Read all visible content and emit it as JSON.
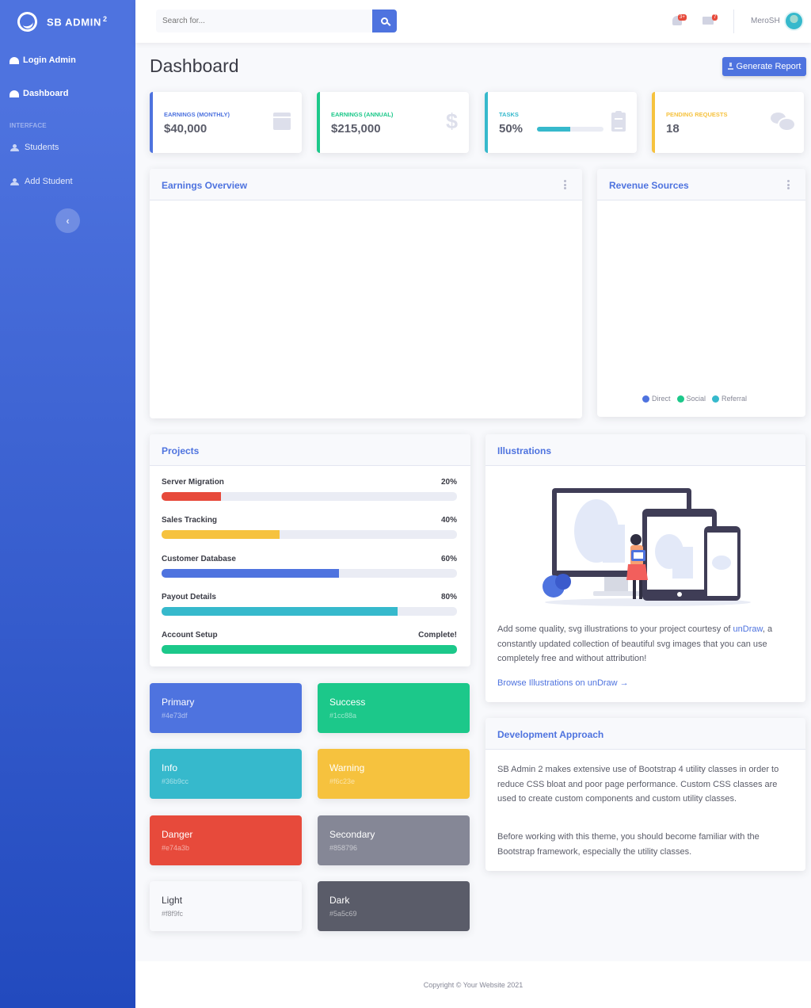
{
  "sidebar": {
    "brand": "SB ADMIN",
    "brand_sup": "2",
    "items": [
      {
        "label": "Login Admin"
      },
      {
        "label": "Dashboard"
      },
      {
        "label": "Students"
      },
      {
        "label": "Add Student"
      }
    ],
    "heading": "Interface",
    "toggle_glyph": "‹"
  },
  "topbar": {
    "search_placeholder": "Search for...",
    "alerts_badge": "3+",
    "messages_badge": "7",
    "user_name": "MeroSH"
  },
  "page": {
    "title": "Dashboard",
    "generate_report": "Generate Report"
  },
  "stats": [
    {
      "label": "Earnings (Monthly)",
      "value": "$40,000",
      "color": "#4e73df",
      "icon": "calendar-icon"
    },
    {
      "label": "Earnings (Annual)",
      "value": "$215,000",
      "color": "#1cc88a",
      "icon": "dollar-icon"
    },
    {
      "label": "Tasks",
      "value": "50%",
      "progress": 50,
      "color": "#36b9cc",
      "icon": "clipboard-icon"
    },
    {
      "label": "Pending Requests",
      "value": "18",
      "color": "#f6c23e",
      "icon": "comments-icon"
    }
  ],
  "earnings_overview": {
    "title": "Earnings Overview"
  },
  "revenue_sources": {
    "title": "Revenue Sources",
    "legend": [
      {
        "label": "Direct",
        "color": "#4e73df"
      },
      {
        "label": "Social",
        "color": "#1cc88a"
      },
      {
        "label": "Referral",
        "color": "#36b9cc"
      }
    ]
  },
  "projects": {
    "title": "Projects",
    "items": [
      {
        "name": "Server Migration",
        "value_label": "20%",
        "percent": 20,
        "color": "#e74a3b"
      },
      {
        "name": "Sales Tracking",
        "value_label": "40%",
        "percent": 40,
        "color": "#f6c23e"
      },
      {
        "name": "Customer Database",
        "value_label": "60%",
        "percent": 60,
        "color": "#4e73df"
      },
      {
        "name": "Payout Details",
        "value_label": "80%",
        "percent": 80,
        "color": "#36b9cc"
      },
      {
        "name": "Account Setup",
        "value_label": "Complete!",
        "percent": 100,
        "color": "#1cc88a"
      }
    ]
  },
  "color_cards": [
    {
      "name": "Primary",
      "hex": "#4e73df",
      "bg": "#4e73df",
      "fg": "#ffffff"
    },
    {
      "name": "Success",
      "hex": "#1cc88a",
      "bg": "#1cc88a",
      "fg": "#ffffff"
    },
    {
      "name": "Info",
      "hex": "#36b9cc",
      "bg": "#36b9cc",
      "fg": "#ffffff"
    },
    {
      "name": "Warning",
      "hex": "#f6c23e",
      "bg": "#f6c23e",
      "fg": "#ffffff"
    },
    {
      "name": "Danger",
      "hex": "#e74a3b",
      "bg": "#e74a3b",
      "fg": "#ffffff"
    },
    {
      "name": "Secondary",
      "hex": "#858796",
      "bg": "#858796",
      "fg": "#ffffff"
    },
    {
      "name": "Light",
      "hex": "#f8f9fc",
      "bg": "#f8f9fc",
      "fg": "#3a3b45"
    },
    {
      "name": "Dark",
      "hex": "#5a5c69",
      "bg": "#5a5c69",
      "fg": "#ffffff"
    }
  ],
  "illustrations": {
    "title": "Illustrations",
    "text_before": "Add some quality, svg illustrations to your project courtesy of ",
    "link": "unDraw",
    "text_after": ", a constantly updated collection of beautiful svg images that you can use completely free and without attribution!",
    "browse": "Browse Illustrations on unDraw →"
  },
  "development": {
    "title": "Development Approach",
    "p1": "SB Admin 2 makes extensive use of Bootstrap 4 utility classes in order to reduce CSS bloat and poor page performance. Custom CSS classes are used to create custom components and custom utility classes.",
    "p2": "Before working with this theme, you should become familiar with the Bootstrap framework, especially the utility classes."
  },
  "footer": {
    "copyright": "Copyright © Your Website 2021"
  }
}
